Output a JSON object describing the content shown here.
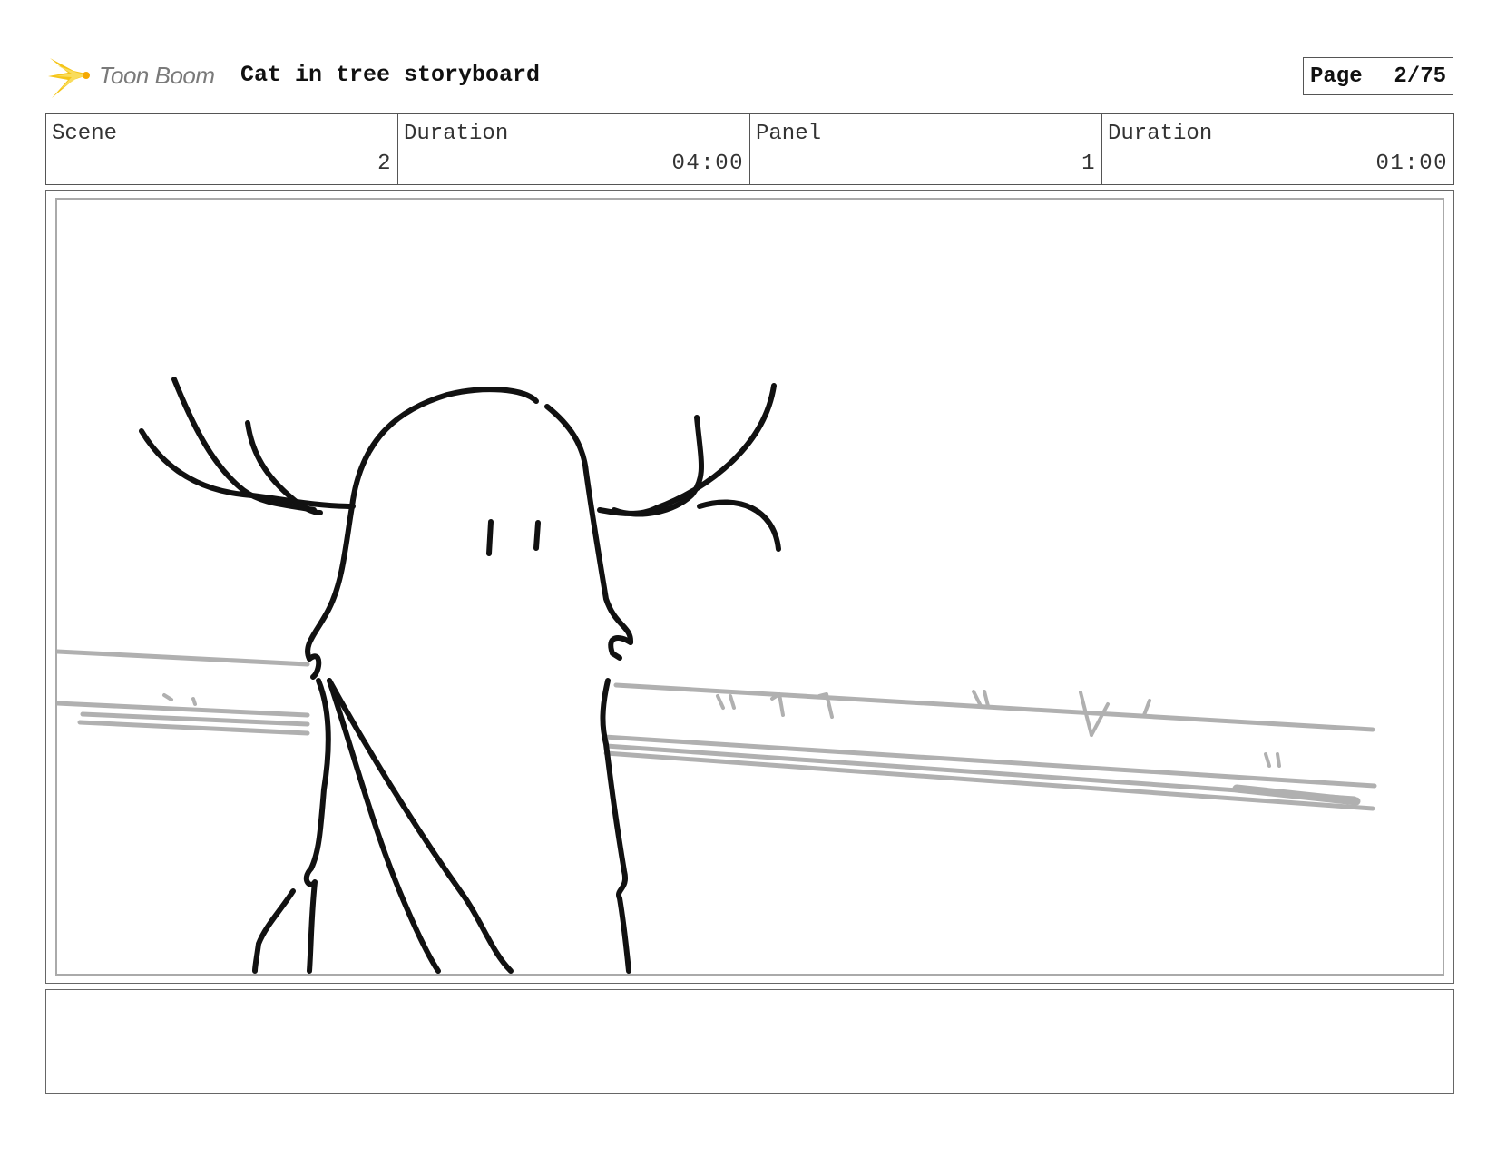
{
  "header": {
    "logo_text": "Toon Boom",
    "title": "Cat in tree storyboard",
    "page_label": "Page",
    "page_value": "2/75"
  },
  "info": {
    "scene_label": "Scene",
    "scene_value": "2",
    "scene_duration_label": "Duration",
    "scene_duration_value": "04:00",
    "panel_label": "Panel",
    "panel_value": "1",
    "panel_duration_label": "Duration",
    "panel_duration_value": "01:00"
  },
  "colors": {
    "logo_accent": "#f5c518",
    "sketch_ink": "#111111",
    "background_lines": "#b0b0b0"
  },
  "icons": {
    "logo": "toon-boom-star-burst-icon"
  }
}
